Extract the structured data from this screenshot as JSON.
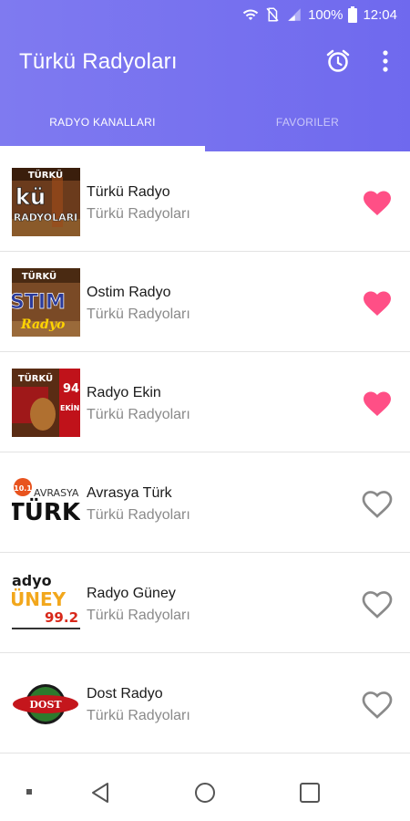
{
  "status_bar": {
    "battery": "100%",
    "time": "12:04",
    "icons": [
      "wifi-icon",
      "no-sim-icon",
      "signal-icon",
      "battery-icon"
    ]
  },
  "app_bar": {
    "title": "Türkü Radyoları",
    "actions": [
      "alarm-icon",
      "more-vert-icon"
    ]
  },
  "tabs": [
    {
      "label": "RADYO KANALLARI",
      "active": true
    },
    {
      "label": "FAVORILER",
      "active": false
    }
  ],
  "stations": [
    {
      "name": "Türkü Radyo",
      "category": "Türkü Radyoları",
      "favorite": true,
      "logo_text": [
        "TÜRKÜ",
        "kü",
        "RADYOLARI"
      ]
    },
    {
      "name": "Ostim Radyo",
      "category": "Türkü Radyoları",
      "favorite": true,
      "logo_text": [
        "TÜRKÜ",
        "STIM",
        "Radyo"
      ]
    },
    {
      "name": "Radyo Ekin",
      "category": "Türkü Radyoları",
      "favorite": true,
      "logo_text": [
        "TÜRKÜ",
        "94",
        "EKİN"
      ]
    },
    {
      "name": "Avrasya Türk",
      "category": "Türkü Radyoları",
      "favorite": false,
      "logo_text": [
        "10.1",
        "AVRASYA",
        "TÜRK"
      ]
    },
    {
      "name": "Radyo Güney",
      "category": "Türkü Radyoları",
      "favorite": false,
      "logo_text": [
        "adyo",
        "ÜNEY",
        "99.2"
      ]
    },
    {
      "name": "Dost Radyo",
      "category": "Türkü Radyoları",
      "favorite": false,
      "logo_text": [
        "DOST"
      ]
    }
  ],
  "nav_bar": [
    "square-dot-icon",
    "back-icon",
    "home-icon",
    "recents-icon"
  ],
  "colors": {
    "app_bar": "#7a75ef",
    "favorite_active": "#ff4f86",
    "favorite_inactive": "#8a8a8a"
  }
}
